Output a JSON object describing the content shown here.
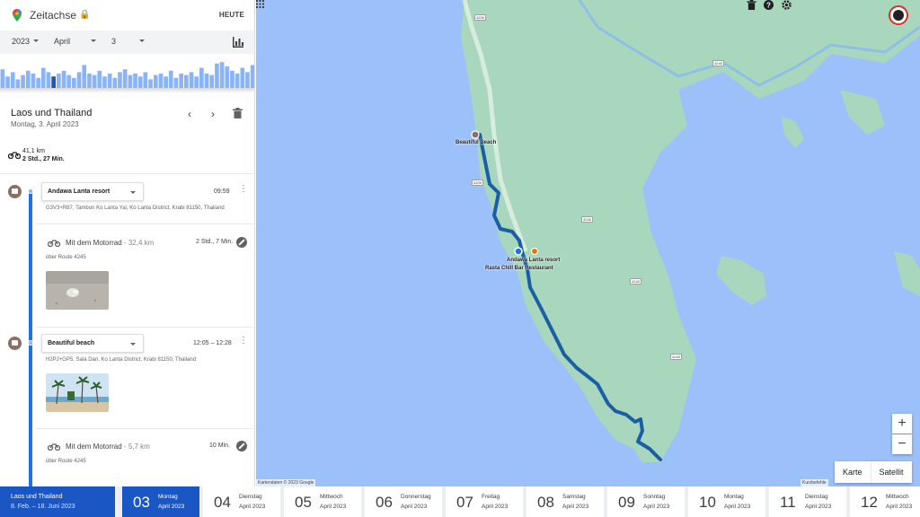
{
  "header": {
    "title": "Zeitachse",
    "today_button": "HEUTE",
    "lock_icon": "lock-icon",
    "logo_icon": "google-maps-pin-icon"
  },
  "date_selector": {
    "year": "2023",
    "month": "April",
    "day": "3",
    "chart_icon": "bar-chart-icon"
  },
  "activity_histogram": {
    "values": [
      0.65,
      0.4,
      0.55,
      0.3,
      0.45,
      0.6,
      0.5,
      0.35,
      0.7,
      0.55,
      0.4,
      0.5,
      0.6,
      0.45,
      0.35,
      0.55,
      0.8,
      0.5,
      0.45,
      0.6,
      0.4,
      0.5,
      0.35,
      0.55,
      0.65,
      0.45,
      0.5,
      0.4,
      0.55,
      0.3,
      0.45,
      0.5,
      0.4,
      0.6,
      0.35,
      0.5,
      0.45,
      0.55,
      0.4,
      0.7,
      0.5,
      0.45,
      0.85,
      0.9,
      0.75,
      0.6,
      0.5,
      0.7,
      0.55,
      0.8
    ],
    "selected_index": 10
  },
  "trip": {
    "title": "Laos und Thailand",
    "date": "Montag, 3. April 2023",
    "summary": {
      "distance": "41,1 km",
      "duration": "2 Std., 27 Min.",
      "mode_icon": "motorcycle-icon"
    }
  },
  "timeline": [
    {
      "type": "place",
      "name": "Andawa Lanta resort",
      "time": "09:59",
      "address": "G3V3+R87, Tambon Ko Lanta Yai, Ko Lanta District, Krabi 81150, Thailand",
      "icon": "hotel-icon"
    },
    {
      "type": "segment",
      "mode": "Mit dem Motorrad",
      "distance": "32,4 km",
      "duration": "2 Std., 7 Min.",
      "route": "über Route 4245",
      "photo": "beach-shell-photo"
    },
    {
      "type": "place",
      "name": "Beautiful beach",
      "time": "12:05 – 12:28",
      "address": "H2PJ+GP5, Sala Dan, Ko Lanta District, Krabi 81150, Thailand",
      "icon": "place-icon",
      "photo": "palm-beach-photo"
    },
    {
      "type": "segment",
      "mode": "Mit dem Motorrad",
      "distance": "5,7 km",
      "duration": "10 Min.",
      "route": "über Route 4245"
    }
  ],
  "map": {
    "labels": {
      "beach": "Beautiful Beach",
      "resort": "Andawa Lanta resort",
      "restaurant": "Rasta Chill Bar Restaurant"
    },
    "roads": [
      "4206",
      "4245",
      "4245",
      "4245",
      "4245",
      "4206"
    ],
    "attribution": "Kartendaten © 2023 Google",
    "shortcuts": "Kurzbefehle",
    "map_types": [
      "Karte",
      "Satellit"
    ],
    "zoom_in": "+",
    "zoom_out": "−",
    "colors": {
      "water": "#9cc0f9",
      "land": "#a8d7be",
      "route": "#1a5fa6",
      "selected": "#1a56c4"
    }
  },
  "bottom_bar": {
    "trip": {
      "title": "Laos und Thailand",
      "range": "8. Feb. – 18. Juni 2023"
    },
    "days": [
      {
        "num": "03",
        "weekday": "Montag",
        "month": "April 2023",
        "selected": true
      },
      {
        "num": "04",
        "weekday": "Dienstag",
        "month": "April 2023"
      },
      {
        "num": "05",
        "weekday": "Mittwoch",
        "month": "April 2023"
      },
      {
        "num": "06",
        "weekday": "Donnerstag",
        "month": "April 2023"
      },
      {
        "num": "07",
        "weekday": "Freitag",
        "month": "April 2023"
      },
      {
        "num": "08",
        "weekday": "Samstag",
        "month": "April 2023"
      },
      {
        "num": "09",
        "weekday": "Sonntag",
        "month": "April 2023"
      },
      {
        "num": "10",
        "weekday": "Montag",
        "month": "April 2023"
      },
      {
        "num": "11",
        "weekday": "Dienstag",
        "month": "April 2023"
      },
      {
        "num": "12",
        "weekday": "Mittwoch",
        "month": "April 2023"
      }
    ]
  }
}
